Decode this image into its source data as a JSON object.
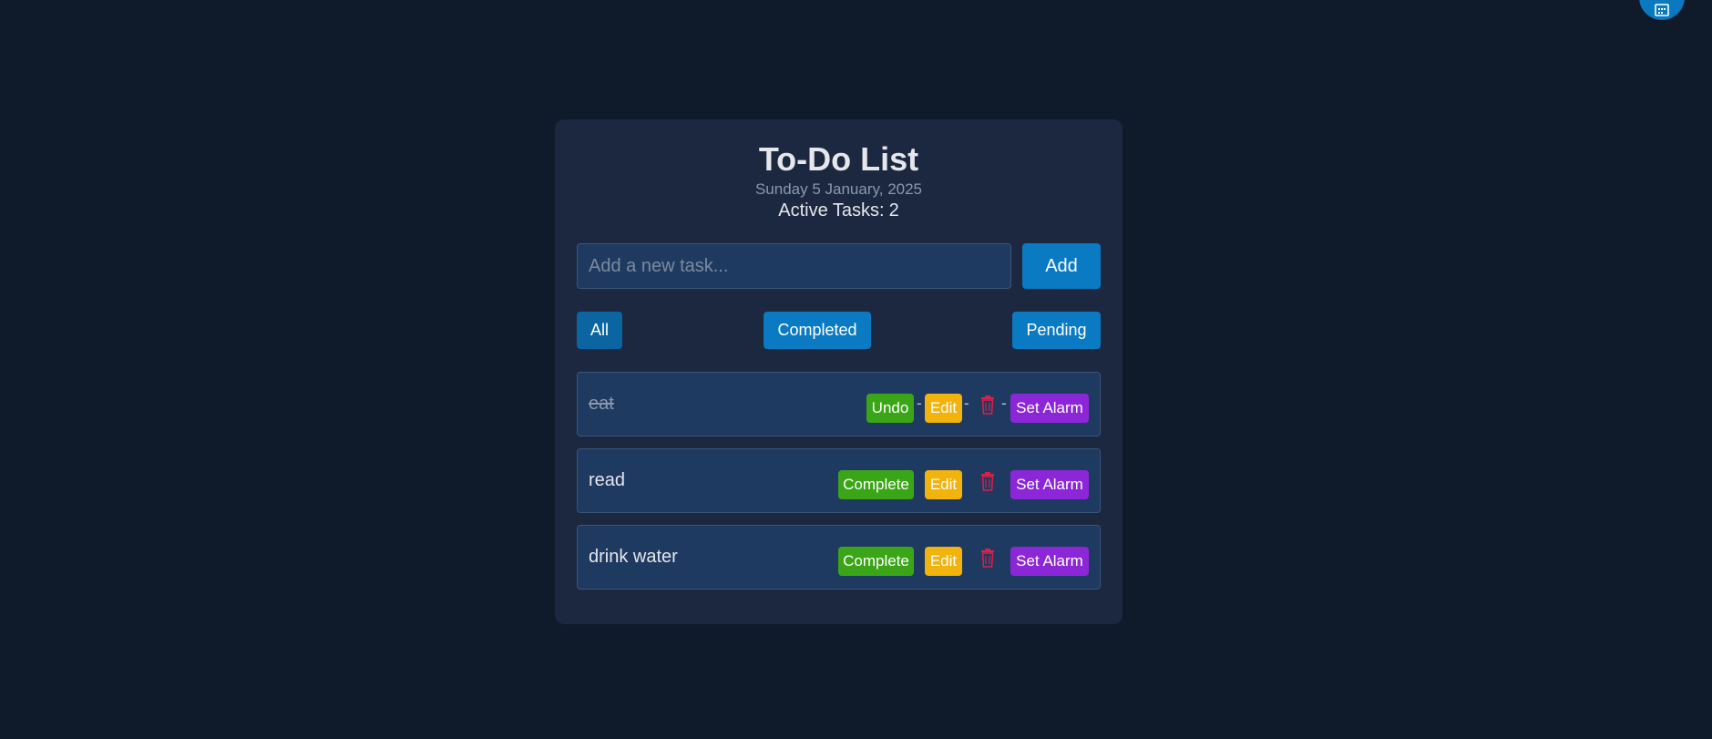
{
  "colors": {
    "page_bg": "#0f1a2b",
    "card_bg": "#1c2740",
    "accent_blue": "#0a7ac2",
    "complete_green": "#3aa617",
    "edit_yellow": "#f1b30c",
    "alarm_purple": "#8c27d8",
    "delete_red": "#e11d48"
  },
  "header": {
    "title": "To-Do List",
    "date": "Sunday 5 January, 2025",
    "active_label": "Active Tasks:",
    "active_count": "2"
  },
  "input": {
    "placeholder": "Add a new task...",
    "value": "",
    "add_label": "Add"
  },
  "filters": {
    "all": "All",
    "completed": "Completed",
    "pending": "Pending",
    "selected": "All"
  },
  "tasks": [
    {
      "text": "eat",
      "completed": true,
      "toggle_label": "Undo",
      "edit_label": "Edit",
      "alarm_label": "Set Alarm",
      "delete_icon": "trash-icon",
      "separator": "-"
    },
    {
      "text": "read",
      "completed": false,
      "toggle_label": "Complete",
      "edit_label": "Edit",
      "alarm_label": "Set Alarm",
      "delete_icon": "trash-icon"
    },
    {
      "text": "drink water",
      "completed": false,
      "toggle_label": "Complete",
      "edit_label": "Edit",
      "alarm_label": "Set Alarm",
      "delete_icon": "trash-icon"
    }
  ],
  "fab": {
    "icon": "calendar-icon"
  }
}
